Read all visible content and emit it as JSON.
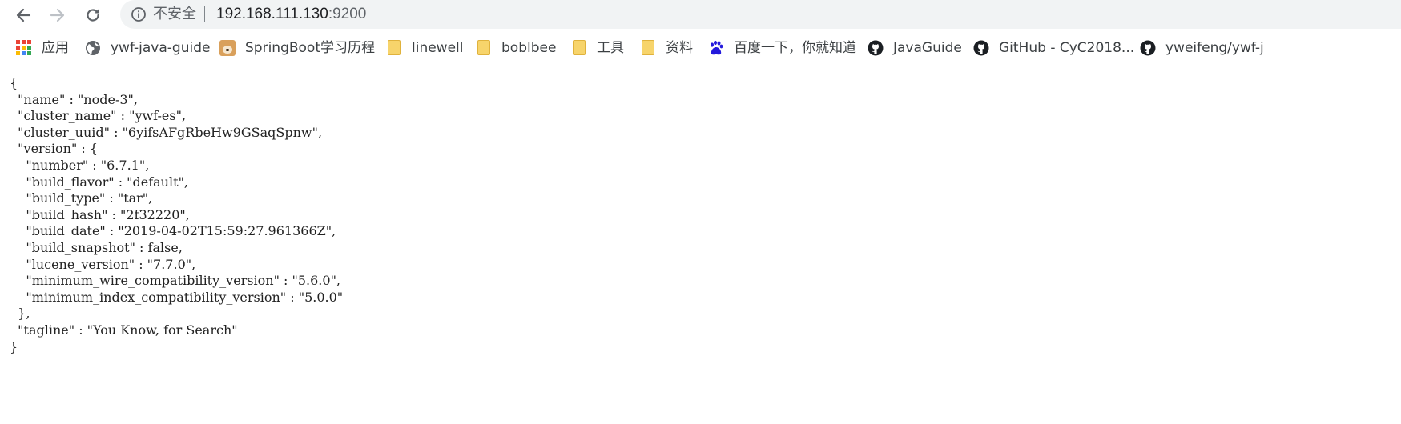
{
  "browser": {
    "security_label": "不安全",
    "url_host": "192.168.111.130",
    "url_port": ":9200",
    "nav": {
      "back_icon": "arrow-left-icon",
      "forward_icon": "arrow-right-icon",
      "reload_icon": "reload-icon",
      "info_icon": "info-icon"
    }
  },
  "bookmarks": [
    {
      "label": "应用",
      "icon": "apps-grid-icon"
    },
    {
      "label": "ywf-java-guide",
      "icon": "globe-icon"
    },
    {
      "label": "SpringBoot学习历程",
      "icon": "shiba-avatar-icon"
    },
    {
      "label": "linewell",
      "icon": "folder-icon"
    },
    {
      "label": "boblbee",
      "icon": "folder-icon"
    },
    {
      "label": "工具",
      "icon": "folder-icon"
    },
    {
      "label": "资料",
      "icon": "folder-icon"
    },
    {
      "label": "百度一下，你就知道",
      "icon": "baidu-paw-icon"
    },
    {
      "label": "JavaGuide",
      "icon": "github-icon"
    },
    {
      "label": "GitHub - CyC2018...",
      "icon": "github-icon"
    },
    {
      "label": "yweifeng/ywf-j",
      "icon": "github-icon"
    }
  ],
  "json_lines": [
    "{",
    "  \"name\" : \"node-3\",",
    "  \"cluster_name\" : \"ywf-es\",",
    "  \"cluster_uuid\" : \"6yifsAFgRbeHw9GSaqSpnw\",",
    "  \"version\" : {",
    "    \"number\" : \"6.7.1\",",
    "    \"build_flavor\" : \"default\",",
    "    \"build_type\" : \"tar\",",
    "    \"build_hash\" : \"2f32220\",",
    "    \"build_date\" : \"2019-04-02T15:59:27.961366Z\",",
    "    \"build_snapshot\" : false,",
    "    \"lucene_version\" : \"7.7.0\",",
    "    \"minimum_wire_compatibility_version\" : \"5.6.0\",",
    "    \"minimum_index_compatibility_version\" : \"5.0.0\"",
    "  },",
    "  \"tagline\" : \"You Know, for Search\"",
    "}"
  ]
}
